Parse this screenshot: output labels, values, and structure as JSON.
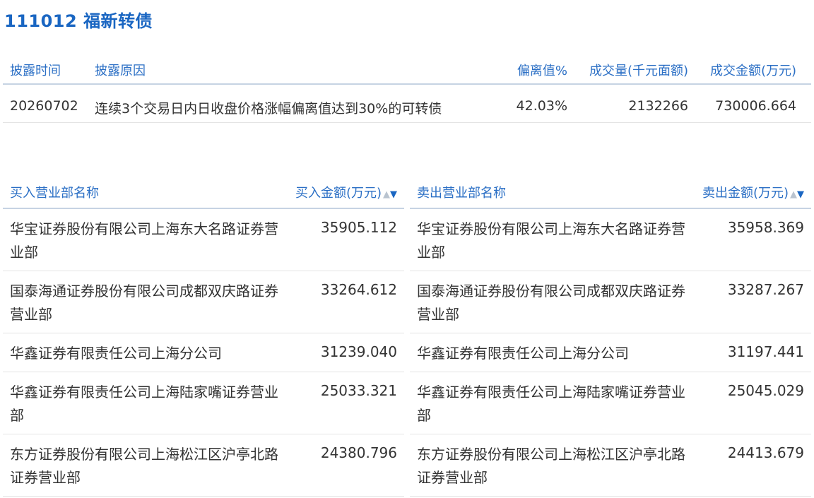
{
  "title": "111012 福新转债",
  "disclosure": {
    "headers": {
      "date": "披露时间",
      "reason": "披露原因",
      "deviation": "偏离值%",
      "volume": "成交量(千元面额)",
      "amount": "成交金额(万元)"
    },
    "row": {
      "date": "20260702",
      "reason": "连续3个交易日内日收盘价格涨幅偏离值达到30%的可转债",
      "deviation": "42.03%",
      "volume": "2132266",
      "amount": "730006.664"
    }
  },
  "buy": {
    "name_header": "买入营业部名称",
    "amount_header": "买入金额(万元)",
    "sort_up_icon": "▲",
    "sort_down_icon": "▼",
    "rows": [
      {
        "name": "华宝证券股份有限公司上海东大名路证券营业部",
        "amount": "35905.112"
      },
      {
        "name": "国泰海通证券股份有限公司成都双庆路证券营业部",
        "amount": "33264.612"
      },
      {
        "name": "华鑫证券有限责任公司上海分公司",
        "amount": "31239.040"
      },
      {
        "name": "华鑫证券有限责任公司上海陆家嘴证券营业部",
        "amount": "25033.321"
      },
      {
        "name": "东方证券股份有限公司上海松江区沪亭北路证券营业部",
        "amount": "24380.796"
      }
    ]
  },
  "sell": {
    "name_header": "卖出营业部名称",
    "amount_header": "卖出金额(万元)",
    "sort_up_icon": "▲",
    "sort_down_icon": "▼",
    "rows": [
      {
        "name": "华宝证券股份有限公司上海东大名路证券营业部",
        "amount": "35958.369"
      },
      {
        "name": "国泰海通证券股份有限公司成都双庆路证券营业部",
        "amount": "33287.267"
      },
      {
        "name": "华鑫证券有限责任公司上海分公司",
        "amount": "31197.441"
      },
      {
        "name": "华鑫证券有限责任公司上海陆家嘴证券营业部",
        "amount": "25045.029"
      },
      {
        "name": "东方证券股份有限公司上海松江区沪亭北路证券营业部",
        "amount": "24413.679"
      }
    ]
  }
}
